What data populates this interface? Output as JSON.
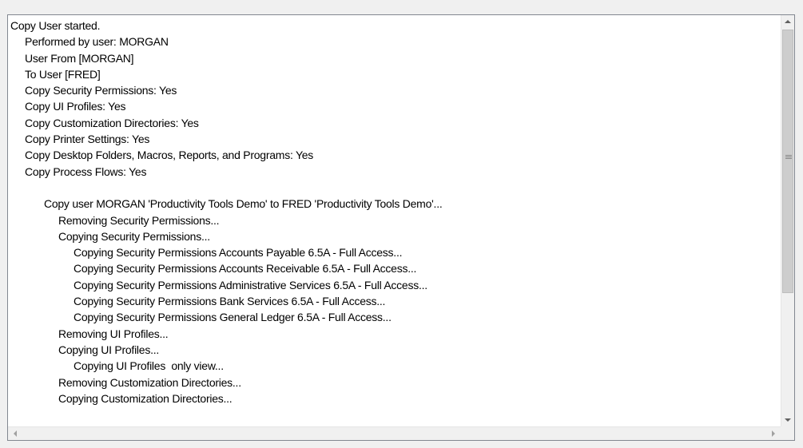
{
  "log": {
    "lines": [
      {
        "indent": 0,
        "text": "Copy User started."
      },
      {
        "indent": 1,
        "text": "Performed by user: MORGAN"
      },
      {
        "indent": 1,
        "text": "User From [MORGAN]"
      },
      {
        "indent": 1,
        "text": "To User [FRED]"
      },
      {
        "indent": 1,
        "text": "Copy Security Permissions: Yes"
      },
      {
        "indent": 1,
        "text": "Copy UI Profiles: Yes"
      },
      {
        "indent": 1,
        "text": "Copy Customization Directories: Yes"
      },
      {
        "indent": 1,
        "text": "Copy Printer Settings: Yes"
      },
      {
        "indent": 1,
        "text": "Copy Desktop Folders, Macros, Reports, and Programs: Yes"
      },
      {
        "indent": 1,
        "text": "Copy Process Flows: Yes"
      },
      {
        "indent": 0,
        "text": ""
      },
      {
        "indent": 2,
        "text": "Copy user MORGAN 'Productivity Tools Demo' to FRED 'Productivity Tools Demo'..."
      },
      {
        "indent": 3,
        "text": "Removing Security Permissions..."
      },
      {
        "indent": 3,
        "text": "Copying Security Permissions..."
      },
      {
        "indent": 4,
        "text": "Copying Security Permissions Accounts Payable 6.5A - Full Access..."
      },
      {
        "indent": 4,
        "text": "Copying Security Permissions Accounts Receivable 6.5A - Full Access..."
      },
      {
        "indent": 4,
        "text": "Copying Security Permissions Administrative Services 6.5A - Full Access..."
      },
      {
        "indent": 4,
        "text": "Copying Security Permissions Bank Services 6.5A - Full Access..."
      },
      {
        "indent": 4,
        "text": "Copying Security Permissions General Ledger 6.5A - Full Access..."
      },
      {
        "indent": 3,
        "text": "Removing UI Profiles..."
      },
      {
        "indent": 3,
        "text": "Copying UI Profiles..."
      },
      {
        "indent": 4,
        "text": "Copying UI Profiles  only view..."
      },
      {
        "indent": 3,
        "text": "Removing Customization Directories..."
      },
      {
        "indent": 3,
        "text": "Copying Customization Directories..."
      }
    ]
  },
  "scrollbars": {
    "vertical_icons": {
      "up": "arrow-up-icon",
      "down": "arrow-down-icon"
    },
    "horizontal_icons": {
      "left": "arrow-left-icon",
      "right": "arrow-right-icon"
    }
  }
}
